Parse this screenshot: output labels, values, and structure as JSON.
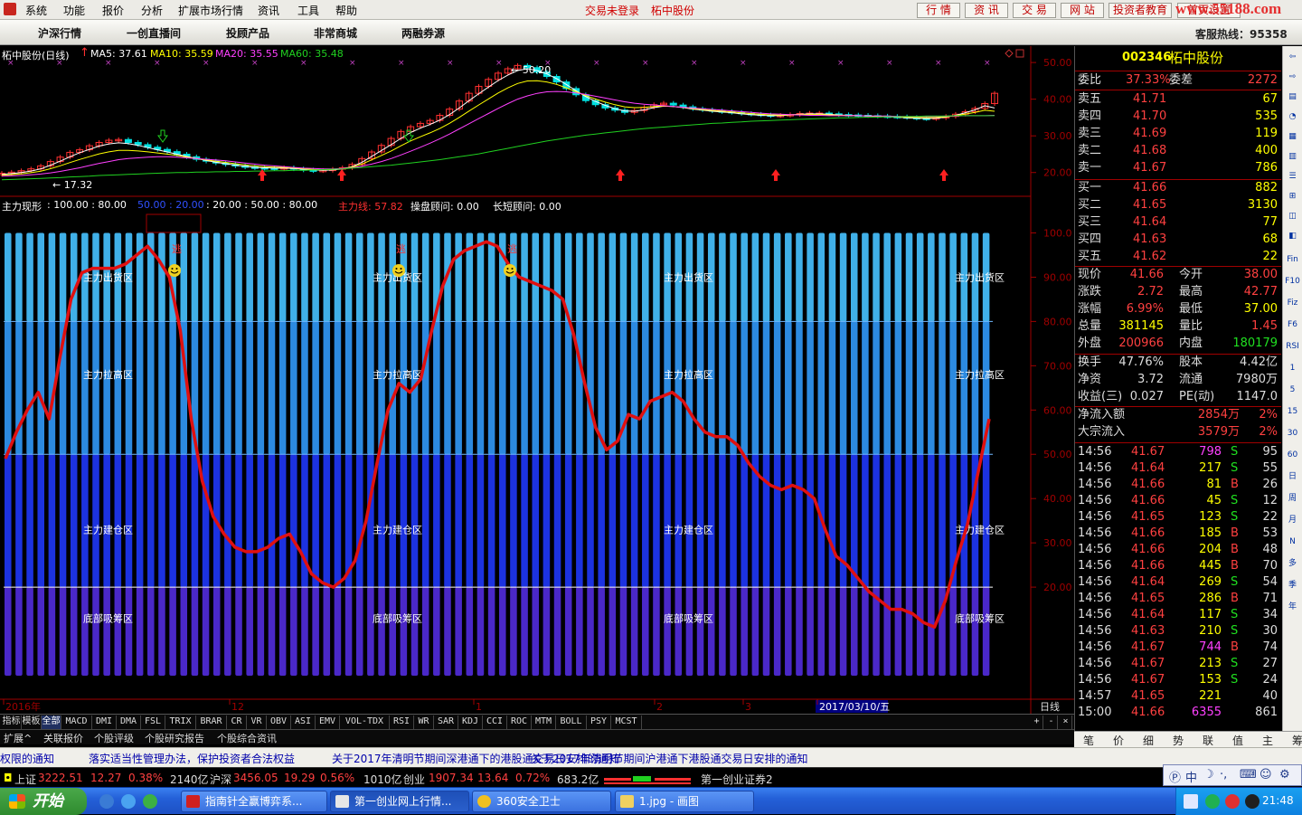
{
  "menubar": {
    "items": [
      "系统",
      "功能",
      "报价",
      "分析",
      "扩展市场行情",
      "资讯",
      "工具",
      "帮助"
    ],
    "status": "交易未登录",
    "stock": "柘中股份",
    "buttons": [
      "行 情",
      "资 讯",
      "交 易",
      "网 站",
      "投资者教育",
      "首页设置"
    ],
    "brand": "www.55188.com"
  },
  "navbar": {
    "items": [
      "沪深行情",
      "一创直播间",
      "投顾产品",
      "非常商城",
      "两融券源"
    ],
    "hotline": "客服热线：95358"
  },
  "kline": {
    "title": "柘中股份(日线)",
    "ma5": "MA5: 37.61",
    "ma10": "MA10: 35.59",
    "ma20": "MA20: 35.55",
    "ma60": "MA60: 35.48",
    "high_label": "50.20",
    "low_label": "17.32",
    "yticks": [
      "50.00",
      "40.00",
      "30.00",
      "20.00"
    ],
    "ylim": [
      15,
      52
    ],
    "series": {
      "close": [
        19.8,
        20.1,
        20.5,
        21.0,
        21.8,
        23.0,
        24.2,
        25.5,
        26.2,
        27.3,
        28.2,
        28.8,
        29.0,
        28.2,
        27.6,
        26.9,
        26.3,
        25.7,
        25.0,
        24.3,
        23.6,
        23.1,
        22.6,
        22.2,
        21.8,
        21.5,
        21.3,
        21.2,
        21.1,
        21.3,
        21.0,
        20.7,
        20.5,
        20.6,
        20.9,
        21.3,
        22.2,
        23.8,
        25.6,
        27.4,
        29.3,
        31.2,
        32.5,
        33.4,
        34.2,
        35.6,
        37.3,
        39.5,
        41.6,
        43.5,
        45.4,
        47.1,
        48.3,
        49.2,
        48.6,
        47.4,
        46.2,
        44.7,
        42.9,
        41.2,
        39.6,
        38.5,
        37.6,
        37.0,
        36.4,
        36.9,
        37.8,
        38.5,
        38.9,
        38.4,
        37.9,
        37.4,
        37.1,
        36.8,
        36.6,
        36.4,
        36.1,
        35.9,
        35.7,
        35.5,
        35.6,
        35.8,
        36.1,
        36.2,
        36.2,
        36.0,
        35.8,
        35.7,
        35.6,
        35.5,
        35.4,
        35.3,
        35.2,
        35.0,
        34.8,
        34.7,
        34.9,
        35.3,
        35.9,
        36.6,
        37.5,
        38.8,
        41.6
      ],
      "ma5": [
        19.5,
        19.7,
        20.0,
        20.4,
        21.0,
        22.0,
        23.1,
        24.3,
        25.4,
        26.3,
        27.2,
        27.8,
        28.1,
        27.9,
        27.4,
        26.8,
        26.2,
        25.6,
        25.0,
        24.4,
        23.8,
        23.3,
        22.8,
        22.4,
        22.0,
        21.7,
        21.4,
        21.3,
        21.2,
        21.2,
        21.1,
        20.9,
        20.7,
        20.6,
        20.7,
        21.0,
        21.6,
        22.8,
        24.4,
        26.0,
        27.6,
        29.3,
        30.9,
        32.1,
        33.1,
        34.3,
        35.8,
        37.6,
        39.6,
        41.5,
        43.3,
        45.1,
        46.6,
        47.8,
        48.3,
        47.8,
        46.9,
        45.6,
        44.0,
        42.3,
        40.7,
        39.4,
        38.3,
        37.4,
        36.8,
        36.7,
        37.1,
        37.7,
        38.1,
        38.0,
        37.7,
        37.3,
        37.0,
        36.7,
        36.5,
        36.3,
        36.0,
        35.8,
        35.6,
        35.5,
        35.5,
        35.7,
        35.9,
        36.0,
        36.0,
        35.9,
        35.7,
        35.6,
        35.5,
        35.4,
        35.3,
        35.2,
        35.1,
        34.9,
        34.8,
        34.7,
        34.8,
        35.1,
        35.6,
        36.3,
        37.1,
        38.2,
        37.6
      ],
      "ma20": [
        19.0,
        19.1,
        19.2,
        19.4,
        19.6,
        19.9,
        20.3,
        20.8,
        21.3,
        21.9,
        22.5,
        23.0,
        23.5,
        23.8,
        24.0,
        24.2,
        24.3,
        24.3,
        24.2,
        24.0,
        23.8,
        23.6,
        23.4,
        23.2,
        22.9,
        22.6,
        22.3,
        22.0,
        21.8,
        21.6,
        21.4,
        21.2,
        21.1,
        21.0,
        21.0,
        21.1,
        21.3,
        21.7,
        22.3,
        23.0,
        23.8,
        24.8,
        25.8,
        26.9,
        28.0,
        29.2,
        30.5,
        31.9,
        33.3,
        34.7,
        36.1,
        37.5,
        38.8,
        40.0,
        40.9,
        41.6,
        42.0,
        42.1,
        42.0,
        41.7,
        41.3,
        40.8,
        40.3,
        39.8,
        39.3,
        38.9,
        38.6,
        38.4,
        38.2,
        38.0,
        37.8,
        37.6,
        37.4,
        37.2,
        37.0,
        36.8,
        36.6,
        36.4,
        36.2,
        36.0,
        35.9,
        35.8,
        35.7,
        35.6,
        35.6,
        35.5,
        35.5,
        35.5,
        35.5,
        35.4,
        35.4,
        35.4,
        35.3,
        35.3,
        35.3,
        35.3,
        35.3,
        35.4,
        35.4,
        35.5,
        35.5,
        35.5,
        35.6
      ],
      "ma60": [
        18.0,
        18.1,
        18.2,
        18.3,
        18.4,
        18.5,
        18.6,
        18.8,
        18.9,
        19.0,
        19.2,
        19.3,
        19.4,
        19.5,
        19.6,
        19.7,
        19.8,
        19.9,
        20.0,
        20.0,
        20.1,
        20.1,
        20.2,
        20.2,
        20.3,
        20.3,
        20.4,
        20.4,
        20.5,
        20.5,
        20.6,
        20.6,
        20.7,
        20.8,
        20.9,
        21.0,
        21.2,
        21.4,
        21.6,
        21.8,
        22.0,
        22.3,
        22.6,
        22.9,
        23.2,
        23.5,
        23.9,
        24.3,
        24.7,
        25.1,
        25.6,
        26.1,
        26.6,
        27.1,
        27.6,
        28.1,
        28.6,
        29.0,
        29.4,
        29.8,
        30.2,
        30.5,
        30.8,
        31.1,
        31.4,
        31.7,
        32.0,
        32.2,
        32.4,
        32.6,
        32.8,
        33.0,
        33.2,
        33.4,
        33.5,
        33.7,
        33.8,
        34.0,
        34.1,
        34.2,
        34.3,
        34.4,
        34.5,
        34.6,
        34.7,
        34.8,
        34.9,
        34.9,
        35.0,
        35.1,
        35.1,
        35.2,
        35.2,
        35.3,
        35.3,
        35.4,
        35.4,
        35.4,
        35.5,
        35.5,
        35.5,
        35.5,
        35.5
      ]
    }
  },
  "indicator": {
    "label": "主力现形",
    "values_a": ": 100.00 : 80.00",
    "values_b": "50.00 : 20.00",
    "values_c": ": 20.00 : 50.00 : 80.00",
    "zhuli": "主力线: 57.82",
    "caopan": "操盘顾问: 0.00",
    "changduan": "长短顾问: 0.00",
    "zones": [
      "主力出货区",
      "主力拉高区",
      "主力建仓区",
      "底部吸筹区"
    ],
    "escape_label": "逃",
    "yticks": [
      "100.0",
      "90.00",
      "80.00",
      "70.00",
      "60.00",
      "50.00",
      "40.00",
      "30.00",
      "20.00"
    ],
    "ylim": [
      0,
      105
    ],
    "line": [
      49,
      55,
      60,
      64,
      58,
      72,
      85,
      91,
      92,
      92,
      92,
      93,
      95,
      97,
      94,
      90,
      78,
      58,
      44,
      36,
      32,
      29,
      28,
      28,
      29,
      31,
      32,
      28,
      23,
      21,
      20,
      22,
      26,
      35,
      48,
      60,
      66,
      64,
      67,
      78,
      88,
      94,
      96,
      97,
      98,
      97,
      93,
      90,
      89,
      88,
      87,
      85,
      77,
      66,
      56,
      51,
      53,
      59,
      58,
      62,
      63,
      64,
      62,
      58,
      55,
      54,
      54,
      52,
      48,
      45,
      43,
      42,
      43,
      42,
      40,
      33,
      27,
      25,
      22,
      19,
      17,
      15,
      15,
      14,
      12,
      11,
      17,
      26,
      34,
      46,
      58
    ]
  },
  "xaxis": {
    "labels": [
      "2016年",
      "12",
      "1",
      "2",
      "3",
      "2017/03/10/五"
    ],
    "period": "日线"
  },
  "tabs1": [
    "指标",
    "模板",
    "全部",
    "MACD",
    "DMI",
    "DMA",
    "FSL",
    "TRIX",
    "BRAR",
    "CR",
    "VR",
    "OBV",
    "ASI",
    "EMV",
    "VOL-TDX",
    "RSI",
    "WR",
    "SAR",
    "KDJ",
    "CCI",
    "ROC",
    "MTM",
    "BOLL",
    "PSY",
    "MCST"
  ],
  "tabs2": [
    "扩展^",
    "关联报价",
    "个股评级",
    "个股研究报告",
    "个股综合资讯"
  ],
  "quote": {
    "code": "002346",
    "name": "柘中股份",
    "weibi_label": "委比",
    "weibi": "37.33%",
    "weicha_label": "委差",
    "weicha": "2272",
    "sell": [
      {
        "label": "卖五",
        "price": "41.71",
        "vol": "67"
      },
      {
        "label": "卖四",
        "price": "41.70",
        "vol": "535"
      },
      {
        "label": "卖三",
        "price": "41.69",
        "vol": "119"
      },
      {
        "label": "卖二",
        "price": "41.68",
        "vol": "400"
      },
      {
        "label": "卖一",
        "price": "41.67",
        "vol": "786"
      }
    ],
    "buy": [
      {
        "label": "买一",
        "price": "41.66",
        "vol": "882"
      },
      {
        "label": "买二",
        "price": "41.65",
        "vol": "3130"
      },
      {
        "label": "买三",
        "price": "41.64",
        "vol": "77"
      },
      {
        "label": "买四",
        "price": "41.63",
        "vol": "68"
      },
      {
        "label": "买五",
        "price": "41.62",
        "vol": "22"
      }
    ],
    "stats": [
      {
        "l1": "现价",
        "v1": "41.66",
        "c1": "#ff4040",
        "l2": "今开",
        "v2": "38.00",
        "c2": "#ff4040"
      },
      {
        "l1": "涨跌",
        "v1": "2.72",
        "c1": "#ff4040",
        "l2": "最高",
        "v2": "42.77",
        "c2": "#ff4040"
      },
      {
        "l1": "涨幅",
        "v1": "6.99%",
        "c1": "#ff4040",
        "l2": "最低",
        "v2": "37.00",
        "c2": "#ffff00"
      },
      {
        "l1": "总量",
        "v1": "381145",
        "c1": "#ffff00",
        "l2": "量比",
        "v2": "1.45",
        "c2": "#ff4040"
      },
      {
        "l1": "外盘",
        "v1": "200966",
        "c1": "#ff4040",
        "l2": "内盘",
        "v2": "180179",
        "c2": "#20e020"
      }
    ],
    "stats2": [
      {
        "l1": "换手",
        "v1": "47.76%",
        "l2": "股本",
        "v2": "4.42亿"
      },
      {
        "l1": "净资",
        "v1": "3.72",
        "l2": "流通",
        "v2": "7980万"
      },
      {
        "l1": "收益(三)",
        "v1": "0.027",
        "l2": "PE(动)",
        "v2": "1147.0"
      }
    ],
    "flow": [
      {
        "label": "净流入额",
        "value": "2854万",
        "pct": "2%"
      },
      {
        "label": "大宗流入",
        "value": "3579万",
        "pct": "2%"
      }
    ],
    "ticks": [
      {
        "t": "14:56",
        "p": "41.67",
        "v": "798",
        "s": "S",
        "n": "95",
        "vc": "#ff40ff"
      },
      {
        "t": "14:56",
        "p": "41.64",
        "v": "217",
        "s": "S",
        "n": "55",
        "vc": "#ffff00"
      },
      {
        "t": "14:56",
        "p": "41.66",
        "v": "81",
        "s": "B",
        "n": "26",
        "vc": "#ffff00"
      },
      {
        "t": "14:56",
        "p": "41.66",
        "v": "45",
        "s": "S",
        "n": "12",
        "vc": "#ffff00"
      },
      {
        "t": "14:56",
        "p": "41.65",
        "v": "123",
        "s": "S",
        "n": "22",
        "vc": "#ffff00"
      },
      {
        "t": "14:56",
        "p": "41.66",
        "v": "185",
        "s": "B",
        "n": "53",
        "vc": "#ffff00"
      },
      {
        "t": "14:56",
        "p": "41.66",
        "v": "204",
        "s": "B",
        "n": "48",
        "vc": "#ffff00"
      },
      {
        "t": "14:56",
        "p": "41.66",
        "v": "445",
        "s": "B",
        "n": "70",
        "vc": "#ffff00"
      },
      {
        "t": "14:56",
        "p": "41.64",
        "v": "269",
        "s": "S",
        "n": "54",
        "vc": "#ffff00"
      },
      {
        "t": "14:56",
        "p": "41.65",
        "v": "286",
        "s": "B",
        "n": "71",
        "vc": "#ffff00"
      },
      {
        "t": "14:56",
        "p": "41.64",
        "v": "117",
        "s": "S",
        "n": "34",
        "vc": "#ffff00"
      },
      {
        "t": "14:56",
        "p": "41.63",
        "v": "210",
        "s": "S",
        "n": "30",
        "vc": "#ffff00"
      },
      {
        "t": "14:56",
        "p": "41.67",
        "v": "744",
        "s": "B",
        "n": "74",
        "vc": "#ff40ff"
      },
      {
        "t": "14:56",
        "p": "41.67",
        "v": "213",
        "s": "S",
        "n": "27",
        "vc": "#ffff00"
      },
      {
        "t": "14:56",
        "p": "41.67",
        "v": "153",
        "s": "S",
        "n": "24",
        "vc": "#ffff00"
      },
      {
        "t": "14:57",
        "p": "41.65",
        "v": "221",
        "s": "",
        "n": "40",
        "vc": "#ffff00"
      },
      {
        "t": "15:00",
        "p": "41.66",
        "v": "6355",
        "s": "",
        "n": "861",
        "vc": "#ff40ff"
      }
    ]
  },
  "rtabs": [
    "笔",
    "价",
    "细",
    "势",
    "联",
    "值",
    "主",
    "筹"
  ],
  "toolstrip": [
    "Fin",
    "F10",
    "Fiz",
    "F6",
    "RSI",
    "1",
    "5",
    "15",
    "30",
    "60",
    "日",
    "周",
    "月",
    "N",
    "多",
    "季",
    "年"
  ],
  "news": [
    "权限的通知",
    "落实适当性管理办法，保护投资者合法权益",
    "关于2017年清明节期间深港通下的港股通交易日安排的通知",
    "关于2017年清明节期间沪港通下港股通交易日安排的通知"
  ],
  "indexbar": {
    "sh_label": "上证",
    "sh": "3222.51",
    "sh_chg": "12.27",
    "sh_pct": "0.38%",
    "sh_amt": "2140亿",
    "sz_label": "沪深",
    "sz": "3456.05",
    "sz_chg": "19.29",
    "sz_pct": "0.56%",
    "sz_amt": "1010亿",
    "cy_label": "创业",
    "cy": "1907.34",
    "cy_chg": "13.64",
    "cy_pct": "0.72%",
    "cy_amt": "683.2亿",
    "broker": "第一创业证券2"
  },
  "ime": {
    "lang": "中"
  },
  "taskbar": {
    "start": "开始",
    "tasks": [
      "指南针全赢博弈系...",
      "第一创业网上行情...",
      "360安全卫士",
      "1.jpg - 画图"
    ],
    "clock": "21:48"
  },
  "colors": {
    "up": "#ff3030",
    "down": "#00e0e0",
    "ma5": "#ffffff",
    "ma10": "#ffff00",
    "ma20": "#ff40ff",
    "ma60": "#20d020"
  }
}
